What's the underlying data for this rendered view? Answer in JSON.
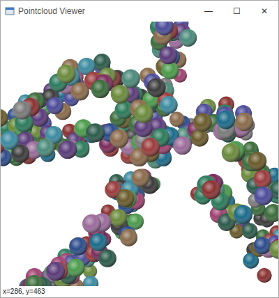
{
  "window": {
    "title": "Pointcloud Viewer",
    "controls": [
      "—",
      "☐",
      "✕"
    ]
  },
  "status_bar": "x=286, y=463"
}
